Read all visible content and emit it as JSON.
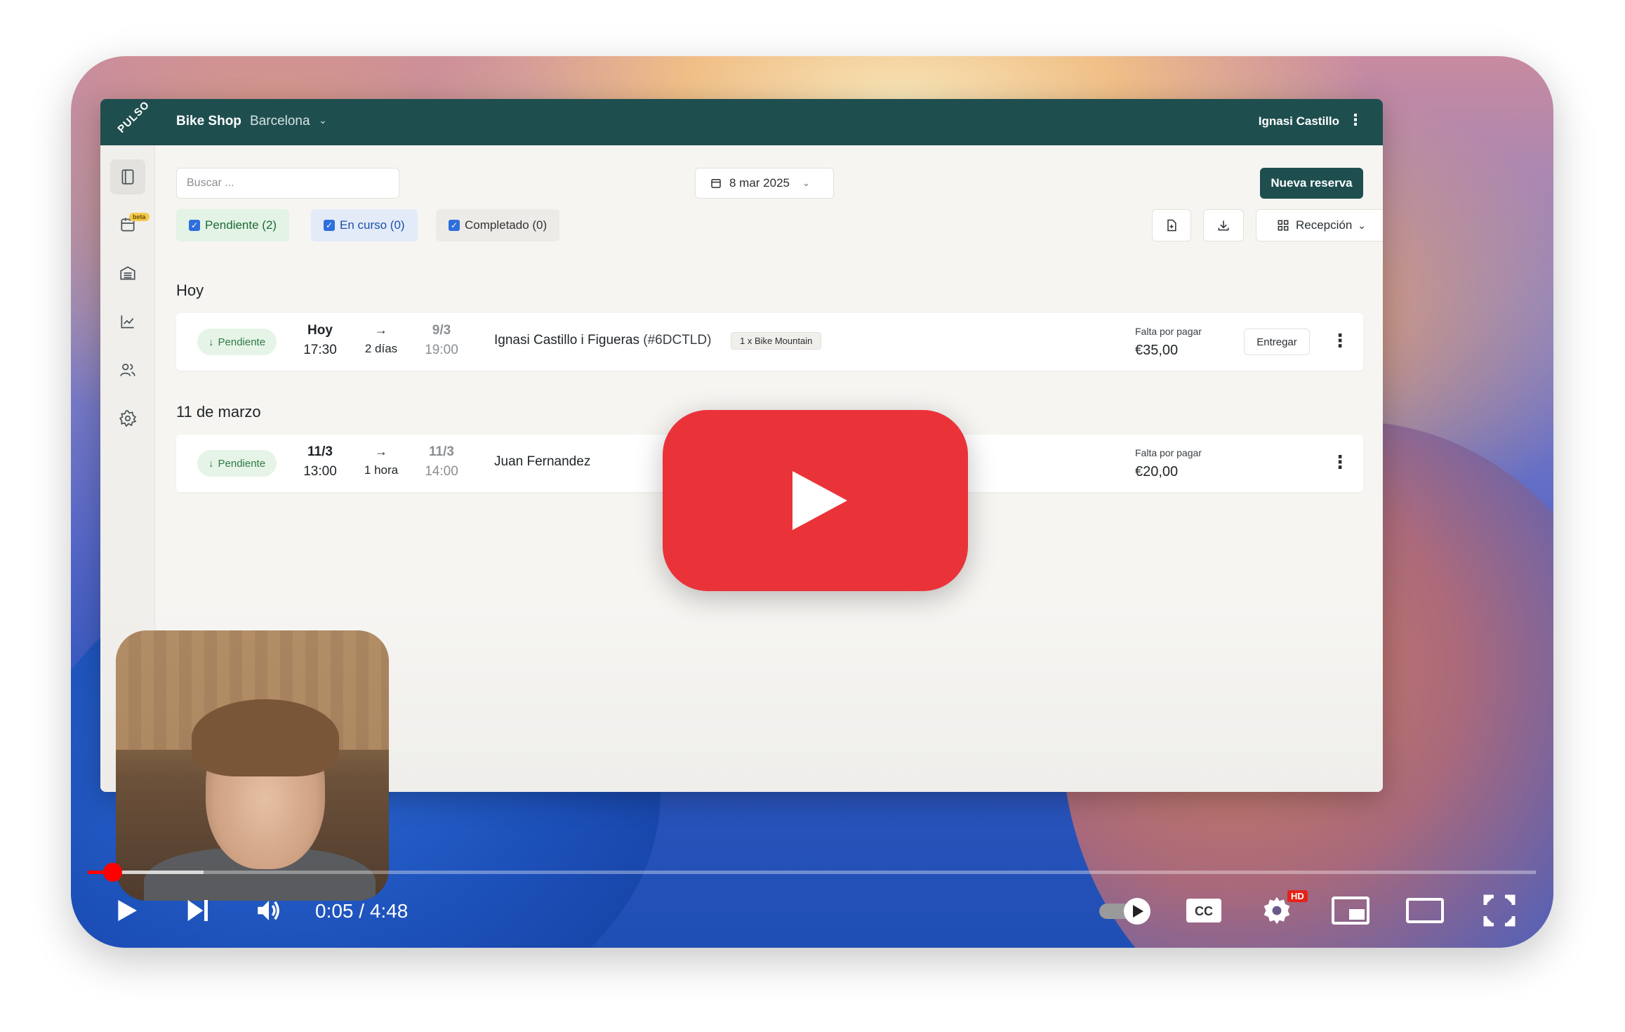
{
  "app": {
    "logo": "PULSO",
    "shop_name": "Bike Shop",
    "city": "Barcelona",
    "user_name": "Ignasi Castillo",
    "search_placeholder": "Buscar ...",
    "date": "8 mar 2025",
    "new_booking": "Nueva reserva",
    "beta": "beta",
    "filters": [
      {
        "label": "Pendiente (2)",
        "checked": true
      },
      {
        "label": "En curso (0)",
        "checked": true
      },
      {
        "label": "Completado (0)",
        "checked": true
      }
    ],
    "view_label": "Recepción",
    "sections": [
      {
        "title": "Hoy",
        "bookings": [
          {
            "status": "Pendiente",
            "start_day": "Hoy",
            "start_time": "17:30",
            "duration": "2 días",
            "end_day": "9/3",
            "end_time": "19:00",
            "customer": "Ignasi Castillo i Figueras",
            "code": "(#6DCTLD)",
            "item": "1 x Bike Mountain",
            "pay_label": "Falta por pagar",
            "pay_amount": "€35,00",
            "action": "Entregar"
          }
        ]
      },
      {
        "title": "11 de marzo",
        "bookings": [
          {
            "status": "Pendiente",
            "start_day": "11/3",
            "start_time": "13:00",
            "duration": "1 hora",
            "end_day": "11/3",
            "end_time": "14:00",
            "customer": "Juan Fernandez",
            "pay_label": "Falta por pagar",
            "pay_amount": "€20,00"
          }
        ]
      }
    ]
  },
  "player": {
    "time": "0:05 / 4:48",
    "progress_fraction": 0.017,
    "buffered_fraction": 0.08,
    "hd_badge": "HD",
    "cc_label": "CC",
    "accent_color": "#ff0000"
  }
}
